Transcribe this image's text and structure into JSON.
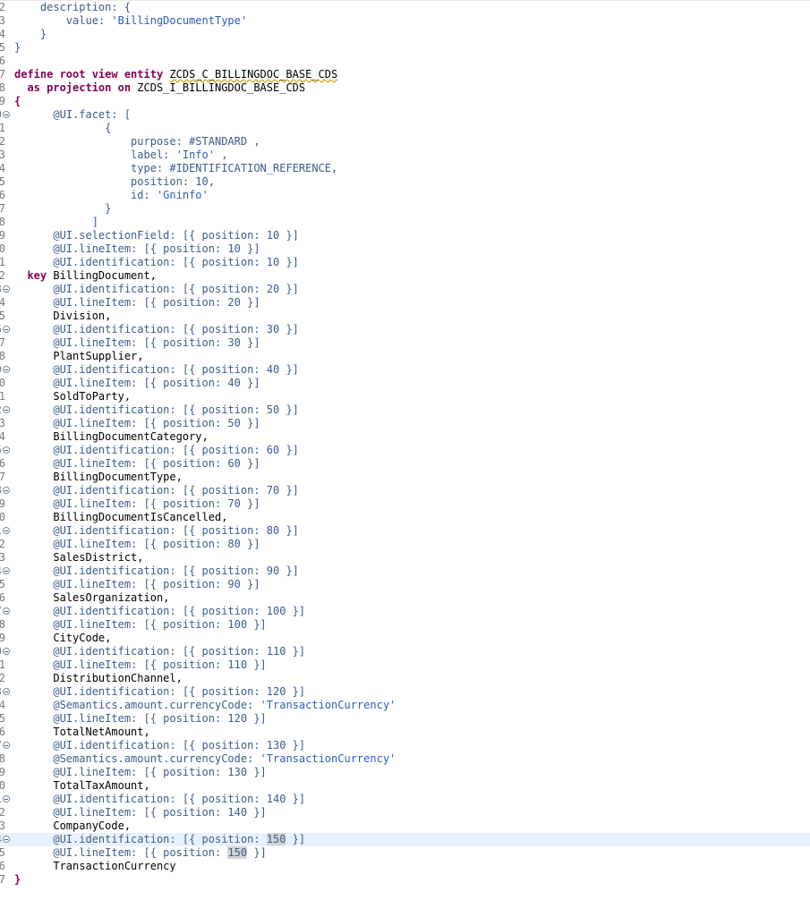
{
  "editor": {
    "language": "ABAP CDS",
    "current_line_number": "4",
    "lines": [
      {
        "num": "2",
        "fold": false,
        "segs": [
          {
            "t": "    ",
            "c": "plain"
          },
          {
            "t": "description: {",
            "c": "ann"
          }
        ]
      },
      {
        "num": "3",
        "fold": false,
        "segs": [
          {
            "t": "        ",
            "c": "plain"
          },
          {
            "t": "value: ",
            "c": "ann"
          },
          {
            "t": "'BillingDocumentType'",
            "c": "str"
          }
        ]
      },
      {
        "num": "4",
        "fold": false,
        "segs": [
          {
            "t": "    ",
            "c": "plain"
          },
          {
            "t": "}",
            "c": "ann"
          }
        ]
      },
      {
        "num": "5",
        "fold": false,
        "segs": [
          {
            "t": "}",
            "c": "ann"
          }
        ]
      },
      {
        "num": "6",
        "fold": false,
        "segs": []
      },
      {
        "num": "7",
        "fold": false,
        "segs": [
          {
            "t": "define root view entity ",
            "c": "kw"
          },
          {
            "t": "ZCDS_C_BILLINGDOC_BASE_CDS",
            "c": "plain err"
          }
        ]
      },
      {
        "num": "8",
        "fold": false,
        "segs": [
          {
            "t": "  ",
            "c": "plain"
          },
          {
            "t": "as projection on ",
            "c": "kw"
          },
          {
            "t": "ZCDS_I_BILLINGDOC_BASE_CDS",
            "c": "plain"
          }
        ]
      },
      {
        "num": "9",
        "fold": false,
        "segs": [
          {
            "t": "{",
            "c": "kw"
          }
        ]
      },
      {
        "num": "0",
        "fold": true,
        "segs": [
          {
            "t": "      ",
            "c": "plain"
          },
          {
            "t": "@UI.facet: [",
            "c": "ann"
          }
        ]
      },
      {
        "num": "1",
        "fold": false,
        "segs": [
          {
            "t": "              ",
            "c": "plain"
          },
          {
            "t": "{",
            "c": "ann"
          }
        ]
      },
      {
        "num": "2",
        "fold": false,
        "segs": [
          {
            "t": "                  ",
            "c": "plain"
          },
          {
            "t": "purpose: #STANDARD ,",
            "c": "ann"
          }
        ]
      },
      {
        "num": "3",
        "fold": false,
        "segs": [
          {
            "t": "                  ",
            "c": "plain"
          },
          {
            "t": "label: ",
            "c": "ann"
          },
          {
            "t": "'Info'",
            "c": "str"
          },
          {
            "t": " ,",
            "c": "ann"
          }
        ]
      },
      {
        "num": "4",
        "fold": false,
        "segs": [
          {
            "t": "                  ",
            "c": "plain"
          },
          {
            "t": "type: #IDENTIFICATION_REFERENCE,",
            "c": "ann"
          }
        ]
      },
      {
        "num": "5",
        "fold": false,
        "segs": [
          {
            "t": "                  ",
            "c": "plain"
          },
          {
            "t": "position: 10,",
            "c": "ann"
          }
        ]
      },
      {
        "num": "6",
        "fold": false,
        "segs": [
          {
            "t": "                  ",
            "c": "plain"
          },
          {
            "t": "id: ",
            "c": "ann"
          },
          {
            "t": "'Gninfo'",
            "c": "str"
          }
        ]
      },
      {
        "num": "7",
        "fold": false,
        "segs": [
          {
            "t": "              ",
            "c": "plain"
          },
          {
            "t": "}",
            "c": "ann"
          }
        ]
      },
      {
        "num": "8",
        "fold": false,
        "segs": [
          {
            "t": "            ",
            "c": "plain"
          },
          {
            "t": "]",
            "c": "ann"
          }
        ]
      },
      {
        "num": "9",
        "fold": false,
        "segs": [
          {
            "t": "      ",
            "c": "plain"
          },
          {
            "t": "@UI.selectionField: [{ position: 10 }]",
            "c": "ann"
          }
        ]
      },
      {
        "num": "0",
        "fold": false,
        "segs": [
          {
            "t": "      ",
            "c": "plain"
          },
          {
            "t": "@UI.lineItem: [{ position: 10 }]",
            "c": "ann"
          }
        ]
      },
      {
        "num": "1",
        "fold": false,
        "segs": [
          {
            "t": "      ",
            "c": "plain"
          },
          {
            "t": "@UI.identification: [{ position: 10 }]",
            "c": "ann"
          }
        ]
      },
      {
        "num": "2",
        "fold": false,
        "segs": [
          {
            "t": "  ",
            "c": "plain"
          },
          {
            "t": "key ",
            "c": "kw"
          },
          {
            "t": "BillingDocument,",
            "c": "plain"
          }
        ]
      },
      {
        "num": "3",
        "fold": true,
        "segs": [
          {
            "t": "      ",
            "c": "plain"
          },
          {
            "t": "@UI.identification: [{ position: 20 }]",
            "c": "ann"
          }
        ]
      },
      {
        "num": "4",
        "fold": false,
        "segs": [
          {
            "t": "      ",
            "c": "plain"
          },
          {
            "t": "@UI.lineItem: [{ position: 20 }]",
            "c": "ann"
          }
        ]
      },
      {
        "num": "5",
        "fold": false,
        "segs": [
          {
            "t": "      ",
            "c": "plain"
          },
          {
            "t": "Division,",
            "c": "plain"
          }
        ]
      },
      {
        "num": "6",
        "fold": true,
        "segs": [
          {
            "t": "      ",
            "c": "plain"
          },
          {
            "t": "@UI.identification: [{ position: 30 }]",
            "c": "ann"
          }
        ]
      },
      {
        "num": "7",
        "fold": false,
        "segs": [
          {
            "t": "      ",
            "c": "plain"
          },
          {
            "t": "@UI.lineItem: [{ position: 30 }]",
            "c": "ann"
          }
        ]
      },
      {
        "num": "8",
        "fold": false,
        "segs": [
          {
            "t": "      ",
            "c": "plain"
          },
          {
            "t": "PlantSupplier,",
            "c": "plain"
          }
        ]
      },
      {
        "num": "9",
        "fold": true,
        "segs": [
          {
            "t": "      ",
            "c": "plain"
          },
          {
            "t": "@UI.identification: [{ position: 40 }]",
            "c": "ann"
          }
        ]
      },
      {
        "num": "0",
        "fold": false,
        "segs": [
          {
            "t": "      ",
            "c": "plain"
          },
          {
            "t": "@UI.lineItem: [{ position: 40 }]",
            "c": "ann"
          }
        ]
      },
      {
        "num": "1",
        "fold": false,
        "segs": [
          {
            "t": "      ",
            "c": "plain"
          },
          {
            "t": "SoldToParty,",
            "c": "plain"
          }
        ]
      },
      {
        "num": "2",
        "fold": true,
        "segs": [
          {
            "t": "      ",
            "c": "plain"
          },
          {
            "t": "@UI.identification: [{ position: 50 }]",
            "c": "ann"
          }
        ]
      },
      {
        "num": "3",
        "fold": false,
        "segs": [
          {
            "t": "      ",
            "c": "plain"
          },
          {
            "t": "@UI.lineItem: [{ position: 50 }]",
            "c": "ann"
          }
        ]
      },
      {
        "num": "4",
        "fold": false,
        "segs": [
          {
            "t": "      ",
            "c": "plain"
          },
          {
            "t": "BillingDocumentCategory,",
            "c": "plain"
          }
        ]
      },
      {
        "num": "5",
        "fold": true,
        "segs": [
          {
            "t": "      ",
            "c": "plain"
          },
          {
            "t": "@UI.identification: [{ position: 60 }]",
            "c": "ann"
          }
        ]
      },
      {
        "num": "6",
        "fold": false,
        "segs": [
          {
            "t": "      ",
            "c": "plain"
          },
          {
            "t": "@UI.lineItem: [{ position: 60 }]",
            "c": "ann"
          }
        ]
      },
      {
        "num": "7",
        "fold": false,
        "segs": [
          {
            "t": "      ",
            "c": "plain"
          },
          {
            "t": "BillingDocumentType,",
            "c": "plain"
          }
        ]
      },
      {
        "num": "8",
        "fold": true,
        "segs": [
          {
            "t": "      ",
            "c": "plain"
          },
          {
            "t": "@UI.identification: [{ position: 70 }]",
            "c": "ann"
          }
        ]
      },
      {
        "num": "9",
        "fold": false,
        "segs": [
          {
            "t": "      ",
            "c": "plain"
          },
          {
            "t": "@UI.lineItem: [{ position: 70 }]",
            "c": "ann"
          }
        ]
      },
      {
        "num": "0",
        "fold": false,
        "segs": [
          {
            "t": "      ",
            "c": "plain"
          },
          {
            "t": "BillingDocumentIsCancelled,",
            "c": "plain"
          }
        ]
      },
      {
        "num": "1",
        "fold": true,
        "segs": [
          {
            "t": "      ",
            "c": "plain"
          },
          {
            "t": "@UI.identification: [{ position: 80 }]",
            "c": "ann"
          }
        ]
      },
      {
        "num": "2",
        "fold": false,
        "segs": [
          {
            "t": "      ",
            "c": "plain"
          },
          {
            "t": "@UI.lineItem: [{ position: 80 }]",
            "c": "ann"
          }
        ]
      },
      {
        "num": "3",
        "fold": false,
        "segs": [
          {
            "t": "      ",
            "c": "plain"
          },
          {
            "t": "SalesDistrict,",
            "c": "plain"
          }
        ]
      },
      {
        "num": "4",
        "fold": true,
        "segs": [
          {
            "t": "      ",
            "c": "plain"
          },
          {
            "t": "@UI.identification: [{ position: 90 }]",
            "c": "ann"
          }
        ]
      },
      {
        "num": "5",
        "fold": false,
        "segs": [
          {
            "t": "      ",
            "c": "plain"
          },
          {
            "t": "@UI.lineItem: [{ position: 90 }]",
            "c": "ann"
          }
        ]
      },
      {
        "num": "6",
        "fold": false,
        "segs": [
          {
            "t": "      ",
            "c": "plain"
          },
          {
            "t": "SalesOrganization,",
            "c": "plain"
          }
        ]
      },
      {
        "num": "7",
        "fold": true,
        "segs": [
          {
            "t": "      ",
            "c": "plain"
          },
          {
            "t": "@UI.identification: [{ position: 100 }]",
            "c": "ann"
          }
        ]
      },
      {
        "num": "8",
        "fold": false,
        "segs": [
          {
            "t": "      ",
            "c": "plain"
          },
          {
            "t": "@UI.lineItem: [{ position: 100 }]",
            "c": "ann"
          }
        ]
      },
      {
        "num": "9",
        "fold": false,
        "segs": [
          {
            "t": "      ",
            "c": "plain"
          },
          {
            "t": "CityCode,",
            "c": "plain"
          }
        ]
      },
      {
        "num": "0",
        "fold": true,
        "segs": [
          {
            "t": "      ",
            "c": "plain"
          },
          {
            "t": "@UI.identification: [{ position: 110 }]",
            "c": "ann"
          }
        ]
      },
      {
        "num": "1",
        "fold": false,
        "segs": [
          {
            "t": "      ",
            "c": "plain"
          },
          {
            "t": "@UI.lineItem: [{ position: 110 }]",
            "c": "ann"
          }
        ]
      },
      {
        "num": "2",
        "fold": false,
        "segs": [
          {
            "t": "      ",
            "c": "plain"
          },
          {
            "t": "DistributionChannel,",
            "c": "plain"
          }
        ]
      },
      {
        "num": "3",
        "fold": true,
        "segs": [
          {
            "t": "      ",
            "c": "plain"
          },
          {
            "t": "@UI.identification: [{ position: 120 }]",
            "c": "ann"
          }
        ]
      },
      {
        "num": "4",
        "fold": false,
        "segs": [
          {
            "t": "      ",
            "c": "plain"
          },
          {
            "t": "@Semantics.amount.currencyCode: ",
            "c": "ann"
          },
          {
            "t": "'TransactionCurrency'",
            "c": "str"
          }
        ]
      },
      {
        "num": "5",
        "fold": false,
        "segs": [
          {
            "t": "      ",
            "c": "plain"
          },
          {
            "t": "@UI.lineItem: [{ position: 120 }]",
            "c": "ann"
          }
        ]
      },
      {
        "num": "6",
        "fold": false,
        "segs": [
          {
            "t": "      ",
            "c": "plain"
          },
          {
            "t": "TotalNetAmount,",
            "c": "plain"
          }
        ]
      },
      {
        "num": "7",
        "fold": true,
        "segs": [
          {
            "t": "      ",
            "c": "plain"
          },
          {
            "t": "@UI.identification: [{ position: 130 }]",
            "c": "ann"
          }
        ]
      },
      {
        "num": "8",
        "fold": false,
        "segs": [
          {
            "t": "      ",
            "c": "plain"
          },
          {
            "t": "@Semantics.amount.currencyCode: ",
            "c": "ann"
          },
          {
            "t": "'TransactionCurrency'",
            "c": "str"
          }
        ]
      },
      {
        "num": "9",
        "fold": false,
        "segs": [
          {
            "t": "      ",
            "c": "plain"
          },
          {
            "t": "@UI.lineItem: [{ position: 130 }]",
            "c": "ann"
          }
        ]
      },
      {
        "num": "0",
        "fold": false,
        "segs": [
          {
            "t": "      ",
            "c": "plain"
          },
          {
            "t": "TotalTaxAmount,",
            "c": "plain"
          }
        ]
      },
      {
        "num": "1",
        "fold": true,
        "segs": [
          {
            "t": "      ",
            "c": "plain"
          },
          {
            "t": "@UI.identification: [{ position: 140 }]",
            "c": "ann"
          }
        ]
      },
      {
        "num": "2",
        "fold": false,
        "segs": [
          {
            "t": "      ",
            "c": "plain"
          },
          {
            "t": "@UI.lineItem: [{ position: 140 }]",
            "c": "ann"
          }
        ]
      },
      {
        "num": "3",
        "fold": false,
        "segs": [
          {
            "t": "      ",
            "c": "plain"
          },
          {
            "t": "CompanyCode,",
            "c": "plain"
          }
        ]
      },
      {
        "num": "4",
        "fold": true,
        "current": true,
        "segs": [
          {
            "t": "      ",
            "c": "plain"
          },
          {
            "t": "@UI.identification: [{ position: ",
            "c": "ann"
          },
          {
            "t": "150",
            "c": "ann hl"
          },
          {
            "t": " }]",
            "c": "ann"
          }
        ]
      },
      {
        "num": "5",
        "fold": false,
        "segs": [
          {
            "t": "      ",
            "c": "plain"
          },
          {
            "t": "@UI.lineItem: [{ position: ",
            "c": "ann"
          },
          {
            "t": "150",
            "c": "ann hl"
          },
          {
            "t": " }]",
            "c": "ann"
          }
        ]
      },
      {
        "num": "6",
        "fold": false,
        "segs": [
          {
            "t": "      ",
            "c": "plain"
          },
          {
            "t": "TransactionCurrency",
            "c": "plain"
          }
        ]
      },
      {
        "num": "7",
        "fold": false,
        "segs": [
          {
            "t": "}",
            "c": "kw"
          }
        ]
      }
    ]
  }
}
